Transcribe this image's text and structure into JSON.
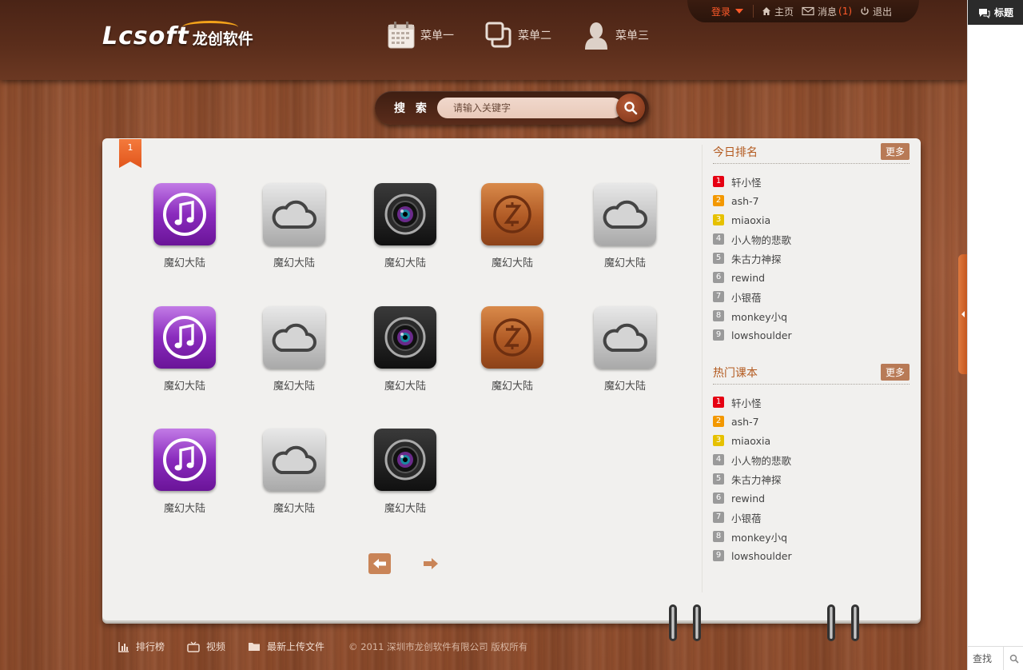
{
  "logo": {
    "mark": "Lcsoft",
    "cn": "龙创软件"
  },
  "main_menu": [
    {
      "label": "菜单一",
      "icon": "calendar-icon"
    },
    {
      "label": "菜单二",
      "icon": "windows-icon"
    },
    {
      "label": "菜单三",
      "icon": "user-icon"
    }
  ],
  "topbar": {
    "login": "登录",
    "home": "主页",
    "messages": "消息",
    "messages_count": "(1)",
    "logout": "退出"
  },
  "search": {
    "label": "搜 索",
    "placeholder": "请输入关键字"
  },
  "panel": {
    "ribbon": "1",
    "apps": [
      {
        "label": "魔幻大陆",
        "icon": "music-icon"
      },
      {
        "label": "魔幻大陆",
        "icon": "cloud-icon"
      },
      {
        "label": "魔幻大陆",
        "icon": "camera-icon"
      },
      {
        "label": "魔幻大陆",
        "icon": "zcoin-icon"
      },
      {
        "label": "魔幻大陆",
        "icon": "cloud-icon"
      },
      {
        "label": "魔幻大陆",
        "icon": "music-icon"
      },
      {
        "label": "魔幻大陆",
        "icon": "cloud-icon"
      },
      {
        "label": "魔幻大陆",
        "icon": "camera-icon"
      },
      {
        "label": "魔幻大陆",
        "icon": "zcoin-icon"
      },
      {
        "label": "魔幻大陆",
        "icon": "cloud-icon"
      },
      {
        "label": "魔幻大陆",
        "icon": "music-icon"
      },
      {
        "label": "魔幻大陆",
        "icon": "cloud-icon"
      },
      {
        "label": "魔幻大陆",
        "icon": "camera-icon"
      }
    ]
  },
  "ranking_today": {
    "title": "今日排名",
    "more": "更多",
    "items": [
      {
        "num": "1",
        "name": "轩小怪"
      },
      {
        "num": "2",
        "name": "ash-7"
      },
      {
        "num": "3",
        "name": "miaoxia"
      },
      {
        "num": "4",
        "name": "小人物的悲歌"
      },
      {
        "num": "5",
        "name": "朱古力神探"
      },
      {
        "num": "6",
        "name": "rewind"
      },
      {
        "num": "7",
        "name": "小银蓓"
      },
      {
        "num": "8",
        "name": "monkey小q"
      },
      {
        "num": "9",
        "name": "lowshoulder"
      }
    ]
  },
  "hot_courses": {
    "title": "热门课本",
    "more": "更多",
    "items": [
      {
        "num": "1",
        "name": "轩小怪"
      },
      {
        "num": "2",
        "name": "ash-7"
      },
      {
        "num": "3",
        "name": "miaoxia"
      },
      {
        "num": "4",
        "name": "小人物的悲歌"
      },
      {
        "num": "5",
        "name": "朱古力神探"
      },
      {
        "num": "6",
        "name": "rewind"
      },
      {
        "num": "7",
        "name": "小银蓓"
      },
      {
        "num": "8",
        "name": "monkey小q"
      },
      {
        "num": "9",
        "name": "lowshoulder"
      }
    ]
  },
  "footer": {
    "links": [
      "排行榜",
      "视频",
      "最新上传文件"
    ],
    "copyright": "© 2011  深圳市龙创软件有限公司  版权所有"
  },
  "rightbar": {
    "title": "标题",
    "search": "查找"
  },
  "colors": {
    "accent": "#e1561c",
    "wood": "#8d4b2b",
    "header": "#4a2416",
    "panel": "#f1f0ee"
  }
}
